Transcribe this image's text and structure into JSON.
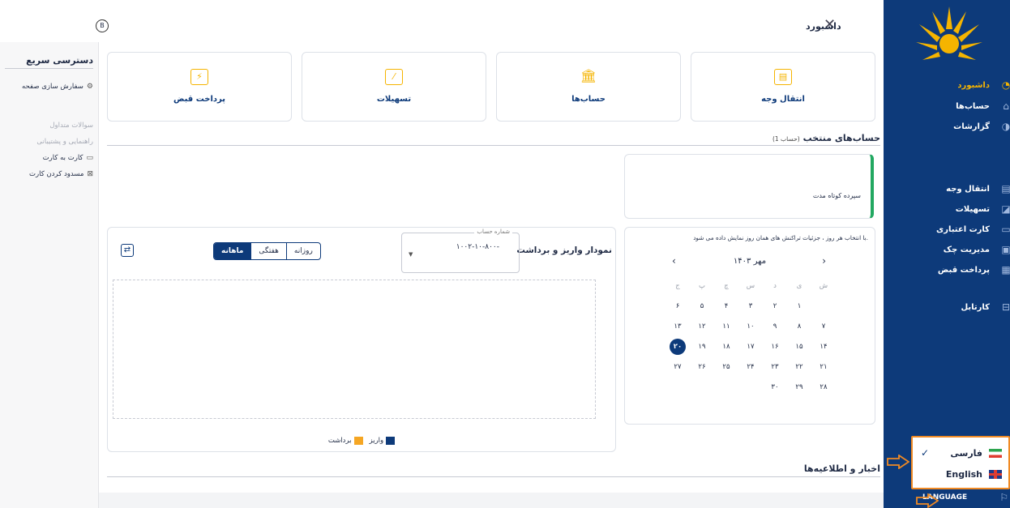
{
  "header": {
    "title": "داشبورد",
    "close_icon": "close-icon",
    "user_icon": "user-circle-icon"
  },
  "sidebar": {
    "logo": "brand-sun-logo",
    "primary": [
      {
        "label": "داشبورد",
        "icon": "dashboard-icon",
        "active": true
      },
      {
        "label": "حساب‌ها",
        "icon": "bank-icon"
      },
      {
        "label": "گزارشات",
        "icon": "pie-chart-icon"
      }
    ],
    "secondary": [
      {
        "label": "انتقال وجه",
        "icon": "wallet-icon"
      },
      {
        "label": "تسهیلات",
        "icon": "loan-icon"
      },
      {
        "label": "کارت اعتباری",
        "icon": "credit-card-icon"
      },
      {
        "label": "مدیریت چک",
        "icon": "check-icon"
      },
      {
        "label": "پرداخت قبض",
        "icon": "bill-icon"
      }
    ],
    "tertiary": [
      {
        "label": "کارتابل",
        "icon": "briefcase-icon"
      }
    ],
    "language_label": "LANGUAGE",
    "accent": "#f5b400",
    "background": "#0d3a7a"
  },
  "language_menu": [
    {
      "label": "فارسی",
      "selected": true,
      "flag": "iran-flag"
    },
    {
      "label": "English",
      "selected": false,
      "flag": "uk-flag"
    }
  ],
  "quick_access": {
    "title": "دسترسی سریع",
    "items": [
      {
        "label": "سفارش سازی صفحه",
        "icon": "gear-icon",
        "muted": false
      },
      {
        "label": "سوالات متداول",
        "muted": true
      },
      {
        "label": "راهنمایی و پشتیبانی",
        "muted": true
      },
      {
        "label": "کارت به کارت",
        "icon": "card-icon",
        "muted": false
      },
      {
        "label": "مسدود کردن کارت",
        "icon": "block-card-icon",
        "muted": false
      }
    ]
  },
  "tiles": [
    {
      "label": "انتقال وجه",
      "icon": "wallet-icon"
    },
    {
      "label": "حساب‌ها",
      "icon": "bank-icon"
    },
    {
      "label": "تسهیلات",
      "icon": "loan-icon"
    },
    {
      "label": "پرداخت قبض",
      "icon": "bill-icon"
    }
  ],
  "selected_accounts": {
    "title": "حساب‌های منتخب",
    "count": "(1 حساب)",
    "account_name": "سپرده کوتاه مدت"
  },
  "calendar": {
    "note": "با انتخاب هر روز ، جزئیات تراکنش های همان روز نمایش داده می شود.",
    "month": "مهر ۱۴۰۳",
    "weekdays": [
      "ش",
      "ی",
      "د",
      "س",
      "چ",
      "پ",
      "ج"
    ],
    "weeks": [
      [
        "",
        "۱",
        "۲",
        "۳",
        "۴",
        "۵",
        "۶"
      ],
      [
        "۷",
        "۸",
        "۹",
        "۱۰",
        "۱۱",
        "۱۲",
        "۱۳"
      ],
      [
        "۱۴",
        "۱۵",
        "۱۶",
        "۱۷",
        "۱۸",
        "۱۹",
        "۲۰"
      ],
      [
        "۲۱",
        "۲۲",
        "۲۳",
        "۲۴",
        "۲۵",
        "۲۶",
        "۲۷"
      ],
      [
        "۲۸",
        "۲۹",
        "۳۰",
        "",
        "",
        "",
        ""
      ]
    ],
    "selected_day": "۲۰"
  },
  "chart": {
    "title": "نمودار واریز و برداشت",
    "account_legend": "شماره حساب",
    "account_value": "۱۰۰۲-۱۰-۸۰۰-",
    "periods": [
      {
        "label": "روزانه",
        "active": false
      },
      {
        "label": "هفتگی",
        "active": false
      },
      {
        "label": "ماهانه",
        "active": true
      }
    ],
    "legend": [
      {
        "label": "واریز",
        "color": "#0d3a7a"
      },
      {
        "label": "برداشت",
        "color": "#f5a623"
      }
    ]
  },
  "news": {
    "title": "اخبار و اطلاعیه‌ها"
  }
}
